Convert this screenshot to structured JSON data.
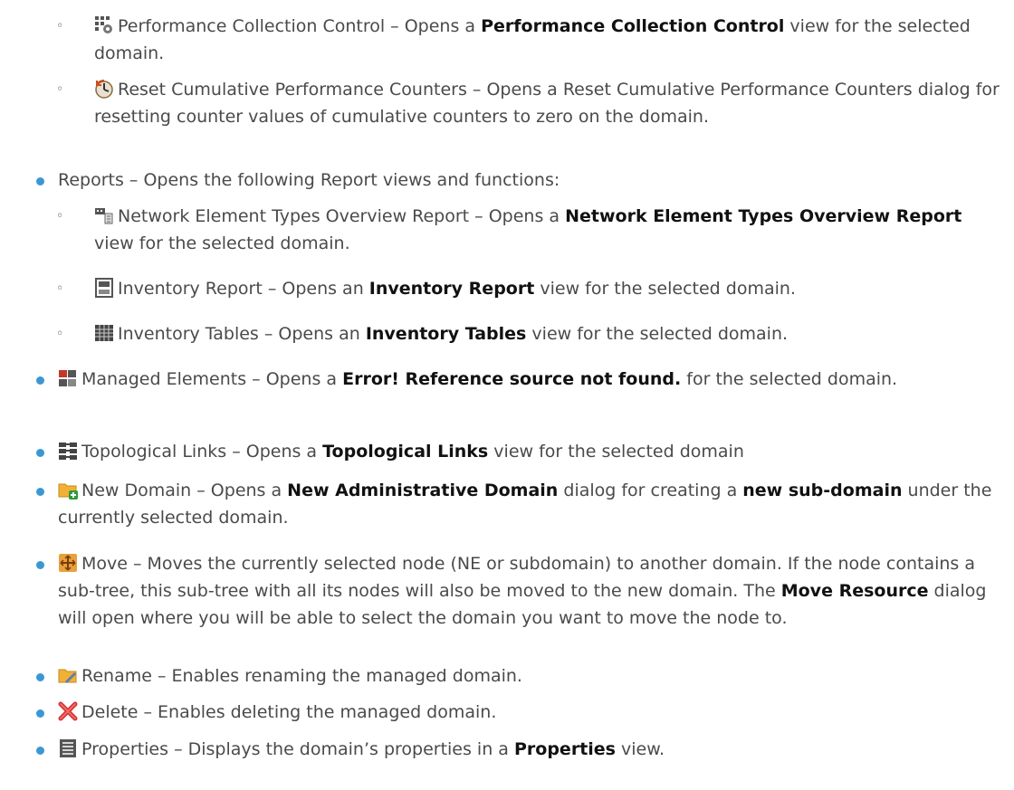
{
  "items": [
    {
      "level": "sub",
      "icon": "performance-collection-icon",
      "name": "Performance Collection Control",
      "pre": " – Opens a ",
      "bold": "Performance Collection Control",
      "post": " view for the selected domain."
    },
    {
      "level": "sub",
      "icon": "reset-counters-icon",
      "name": "Reset Cumulative Performance Counters",
      "pre": " – Opens a Reset Cumulative Performance Counters dialog for resetting counter values of cumulative counters to zero on the domain.",
      "bold": "",
      "post": ""
    },
    {
      "level": "top",
      "icon": "",
      "name": "Reports",
      "pre": " – Opens the following Report views and functions:",
      "bold": "",
      "post": ""
    },
    {
      "level": "sub",
      "icon": "ne-types-report-icon",
      "name": "Network Element Types Overview Report",
      "pre": " – Opens a ",
      "bold": "Network Element Types Overview Report",
      "post": " view for the selected domain."
    },
    {
      "level": "sub",
      "icon": "inventory-report-icon",
      "name": "Inventory Report",
      "pre": " – Opens an ",
      "bold": "Inventory Report",
      "post": " view for the selected domain."
    },
    {
      "level": "sub",
      "icon": "inventory-tables-icon",
      "name": "Inventory Tables",
      "pre": " – Opens an ",
      "bold": "Inventory Tables",
      "post": " view for the selected domain."
    },
    {
      "level": "top",
      "icon": "managed-elements-icon",
      "name": "Managed Elements",
      "pre": " – Opens a ",
      "bold": "Error! Reference source not found.",
      "post": " for the selected domain."
    },
    {
      "level": "top",
      "icon": "topological-links-icon",
      "name": "Topological Links",
      "pre": " – Opens a ",
      "bold": "Topological Links",
      "post": " view for the selected domain"
    },
    {
      "level": "top",
      "icon": "new-domain-icon",
      "name": "New Domain",
      "pre": " – Opens a ",
      "bold": "New Administrative Domain",
      "post": " dialog for creating a ",
      "bold2": "new sub-domain",
      "post2": " under the currently selected domain."
    },
    {
      "level": "top",
      "icon": "move-icon",
      "name": "Move",
      "pre": " – Moves the currently selected node (NE or subdomain) to another domain. If the node contains a sub-tree, this sub-tree with all its nodes will also be moved to the new domain. The ",
      "bold": "Move Resource",
      "post": " dialog will open where you will be able to select the domain you want to move the node to."
    },
    {
      "level": "top",
      "icon": "rename-icon",
      "name": "Rename",
      "pre": " – Enables renaming the managed domain.",
      "bold": "",
      "post": ""
    },
    {
      "level": "top",
      "icon": "delete-icon",
      "name": "Delete",
      "pre": " – Enables deleting the managed domain.",
      "bold": "",
      "post": ""
    },
    {
      "level": "top",
      "icon": "properties-icon",
      "name": "Properties",
      "pre": " – Displays the domain’s properties in a ",
      "bold": "Properties",
      "post": " view."
    }
  ]
}
